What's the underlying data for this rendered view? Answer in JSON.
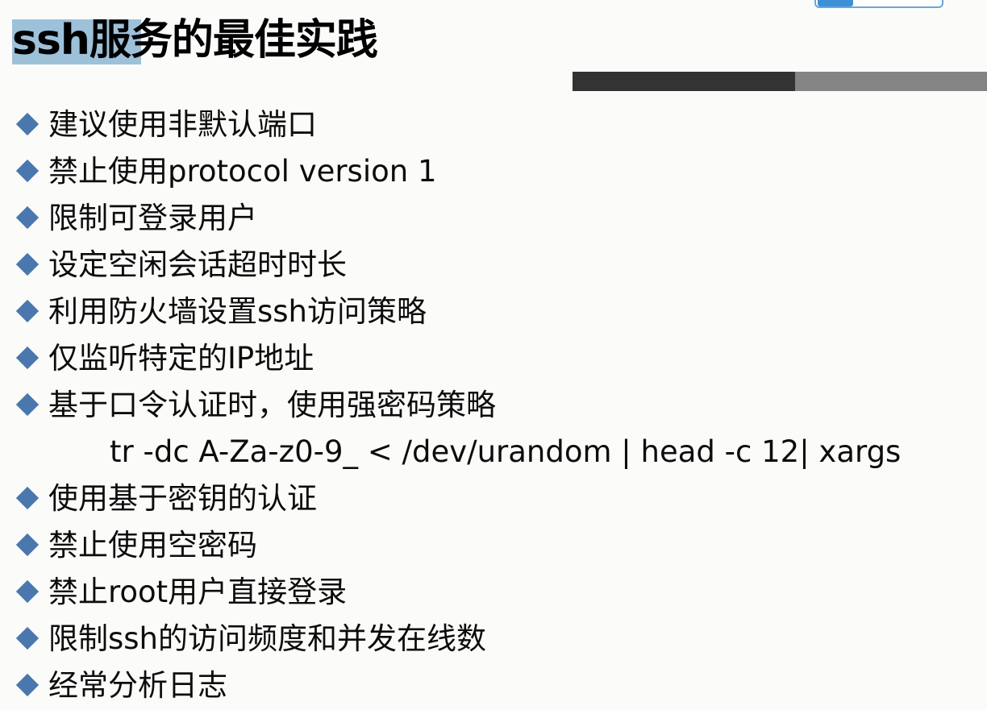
{
  "slide": {
    "title": "ssh服务的最佳实践",
    "bullets": [
      "建议使用非默认端口",
      "禁止使用protocol version 1",
      "限制可登录用户",
      "设定空闲会话超时时长",
      "利用防火墙设置ssh访问策略",
      "仅监听特定的IP地址",
      "基于口令认证时，使用强密码策略",
      "使用基于密钥的认证",
      "禁止使用空密码",
      "禁止root用户直接登录",
      "限制ssh的访问频度和并发在线数",
      "经常分析日志"
    ],
    "code_example": "tr -dc A-Za-z0-9_ < /dev/urandom | head -c 12| xargs"
  },
  "colors": {
    "title_highlight": "#9ec1da",
    "bullet_diamond": "#4a77ad",
    "bar_dark": "#333333",
    "bar_light": "#848484",
    "background": "#fbfcf9"
  },
  "icons": {
    "bullet": "diamond-bullet-icon"
  }
}
